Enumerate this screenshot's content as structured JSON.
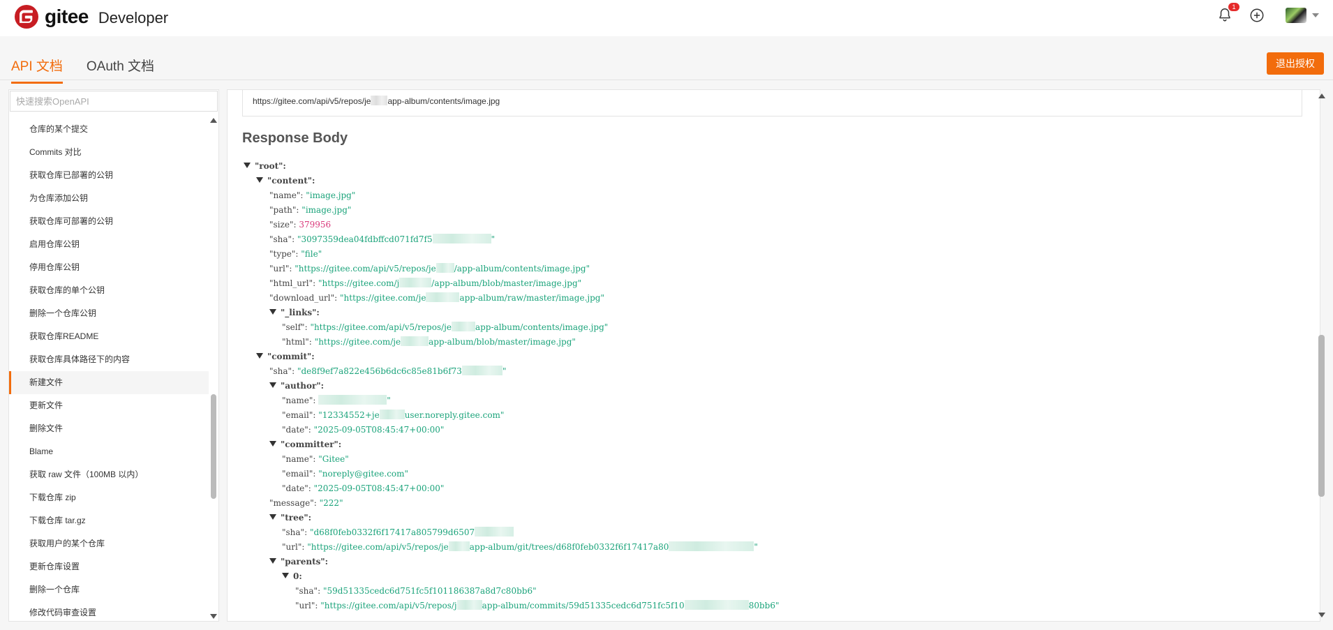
{
  "header": {
    "brand": "gitee",
    "subtitle": "Developer",
    "notification_count": "1"
  },
  "tabs": [
    {
      "label": "API 文档",
      "active": true
    },
    {
      "label": "OAuth 文档",
      "active": false
    }
  ],
  "logout_label": "退出授权",
  "sidebar": {
    "search_placeholder": "快速搜索OpenAPI",
    "items": [
      {
        "label": "仓库的某个提交"
      },
      {
        "label": "Commits 对比"
      },
      {
        "label": "获取仓库已部署的公钥"
      },
      {
        "label": "为仓库添加公钥"
      },
      {
        "label": "获取仓库可部署的公钥"
      },
      {
        "label": "启用仓库公钥"
      },
      {
        "label": "停用仓库公钥"
      },
      {
        "label": "获取仓库的单个公钥"
      },
      {
        "label": "删除一个仓库公钥"
      },
      {
        "label": "获取仓库README"
      },
      {
        "label": "获取仓库具体路径下的内容"
      },
      {
        "label": "新建文件",
        "active": true
      },
      {
        "label": "更新文件"
      },
      {
        "label": "删除文件"
      },
      {
        "label": "Blame"
      },
      {
        "label": "获取 raw 文件（100MB 以内）"
      },
      {
        "label": "下载仓库 zip"
      },
      {
        "label": "下载仓库 tar.gz"
      },
      {
        "label": "获取用户的某个仓库"
      },
      {
        "label": "更新仓库设置"
      },
      {
        "label": "删除一个仓库"
      },
      {
        "label": "修改代码审查设置"
      }
    ]
  },
  "main": {
    "request_url_parts": [
      "https://gitee.com/api/v5/repos/je",
      "app-album/contents/image.jpg"
    ],
    "response_title": "Response Body",
    "tree": {
      "root": "\"root\":",
      "content": "\"content\":",
      "name_key": "\"name\": ",
      "name_val": "\"image.jpg\"",
      "path_key": "\"path\": ",
      "path_val": "\"image.jpg\"",
      "size_key": "\"size\": ",
      "size_val": "379956",
      "sha_key": "\"sha\": ",
      "sha_val": "\"3097359dea04fdbffcd071fd7f5",
      "type_key": "\"type\": ",
      "type_val": "\"file\"",
      "url_key": "\"url\": ",
      "url_val_a": "\"https://gitee.com/api/v5/repos/je",
      "url_val_b": "/app-album/contents/image.jpg\"",
      "html_url_key": "\"html_url\": ",
      "html_url_val_a": "\"https://gitee.com/j",
      "html_url_val_b": "/app-album/blob/master/image.jpg\"",
      "download_url_key": "\"download_url\": ",
      "download_url_val_a": "\"https://gitee.com/je",
      "download_url_val_b": "app-album/raw/master/image.jpg\"",
      "links": "\"_links\":",
      "self_key": "\"self\": ",
      "self_val_a": "\"https://gitee.com/api/v5/repos/je",
      "self_val_b": "app-album/contents/image.jpg\"",
      "html_key": "\"html\": ",
      "html_val_a": "\"https://gitee.com/je",
      "html_val_b": "app-album/blob/master/image.jpg\"",
      "commit": "\"commit\":",
      "commit_sha_key": "\"sha\": ",
      "commit_sha_val": "\"de8f9ef7a822e456b6dc6c85e81b6f73",
      "author": "\"author\":",
      "author_name_key": "\"name\": ",
      "author_name_val_end": "\"",
      "author_email_key": "\"email\": ",
      "author_email_val_a": "\"12334552+je",
      "author_email_val_b": "user.noreply.gitee.com\"",
      "author_date_key": "\"date\": ",
      "author_date_val": "\"2025-09-05T08:45:47+00:00\"",
      "committer": "\"committer\":",
      "committer_name_key": "\"name\": ",
      "committer_name_val": "\"Gitee\"",
      "committer_email_key": "\"email\": ",
      "committer_email_val": "\"noreply@gitee.com\"",
      "committer_date_key": "\"date\": ",
      "committer_date_val": "\"2025-09-05T08:45:47+00:00\"",
      "message_key": "\"message\": ",
      "message_val": "\"222\"",
      "tree_label": "\"tree\":",
      "tree_sha_key": "\"sha\": ",
      "tree_sha_val": "\"d68f0feb0332f6f17417a805799d6507",
      "tree_url_key": "\"url\": ",
      "tree_url_val_a": "\"https://gitee.com/api/v5/repos/je",
      "tree_url_val_b": "app-album/git/trees/d68f0feb0332f6f17417a80",
      "tree_url_val_end": "\"",
      "parents": "\"parents\":",
      "zero": "0:",
      "parent_sha_key": "\"sha\": ",
      "parent_sha_val": "\"59d51335cedc6d751fc5f101186387a8d7c80bb6\"",
      "parent_url_key": "\"url\": ",
      "parent_url_val_a": "\"https://gitee.com/api/v5/repos/j",
      "parent_url_val_b": "app-album/commits/59d51335cedc6d751fc5f10",
      "parent_url_val_c": "80bb6\""
    }
  }
}
